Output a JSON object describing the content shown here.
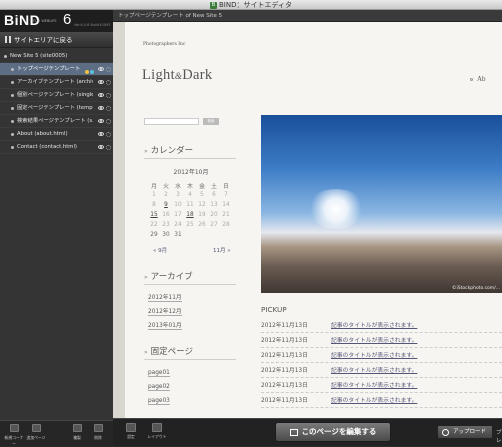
{
  "window": {
    "title": "BIND：サイトエディタ",
    "app_icon": "B"
  },
  "sidebar": {
    "brand": "BiND",
    "brand_sub": "FOR WEBLIFE",
    "version": "6",
    "build": "Ver.6.0.6 Build10093",
    "back_label": "サイトエリアに戻る",
    "items": [
      {
        "label": "New Site 5 (site0005)"
      },
      {
        "label": "トップページテンプレート"
      },
      {
        "label": "アーカイブテンプレート (archiv..."
      },
      {
        "label": "個別ページテンプレート (single..."
      },
      {
        "label": "固定ページテンプレート (templ..."
      },
      {
        "label": "検索結果ページテンプレート (s..."
      },
      {
        "label": "About (about.html)"
      },
      {
        "label": "Contact (contact.html)"
      }
    ],
    "bottom_buttons": [
      {
        "label": "新規コーナー"
      },
      {
        "label": "追加ページ"
      },
      {
        "label": "複製"
      },
      {
        "label": "削除"
      }
    ]
  },
  "breadcrumb": "トップページテンプレート  of New Site 5",
  "page": {
    "company": "Photographers Inc",
    "logo_a": "Light",
    "logo_amp": "&",
    "logo_b": "Dark",
    "nav": "Ab",
    "search_button": "検索",
    "calendar_title": "カレンダー",
    "calendar_month": "2012年10月",
    "weekdays": [
      "月",
      "火",
      "水",
      "木",
      "金",
      "土",
      "日"
    ],
    "weeks": [
      [
        "1",
        "2",
        "3",
        "4",
        "5",
        "6",
        "7"
      ],
      [
        "8",
        "9",
        "10",
        "11",
        "12",
        "13",
        "14"
      ],
      [
        "15",
        "16",
        "17",
        "18",
        "19",
        "20",
        "21"
      ],
      [
        "22",
        "23",
        "24",
        "25",
        "26",
        "27",
        "28"
      ],
      [
        "29",
        "30",
        "31",
        "",
        "",
        "",
        ""
      ]
    ],
    "cal_prev": "« 9月",
    "cal_next": "11月 »",
    "archive_title": "アーカイブ",
    "archives": [
      "2012年11月",
      "2012年12月",
      "2013年01月"
    ],
    "fixed_title": "固定ページ",
    "fixed_pages": [
      "page01",
      "page02",
      "page03"
    ],
    "image_credit": "©iStockphoto.com/...",
    "pickup_title": "PICKUP",
    "pickup": [
      {
        "date": "2012年11月13日",
        "title": "記事のタイトルが表示されます。"
      },
      {
        "date": "2012年11月13日",
        "title": "記事のタイトルが表示されます。"
      },
      {
        "date": "2012年11月13日",
        "title": "記事のタイトルが表示されます。"
      },
      {
        "date": "2012年11月13日",
        "title": "記事のタイトルが表示されます。"
      },
      {
        "date": "2012年11月13日",
        "title": "記事のタイトルが表示されます。"
      },
      {
        "date": "2012年11月13日",
        "title": "記事のタイトルが表示されます。"
      }
    ]
  },
  "toolbar": {
    "settings_label": "設定",
    "layout_label": "レイアウト",
    "edit_label": "このページを編集する",
    "upload_label": "アップロード",
    "preview_label": "プレ"
  }
}
